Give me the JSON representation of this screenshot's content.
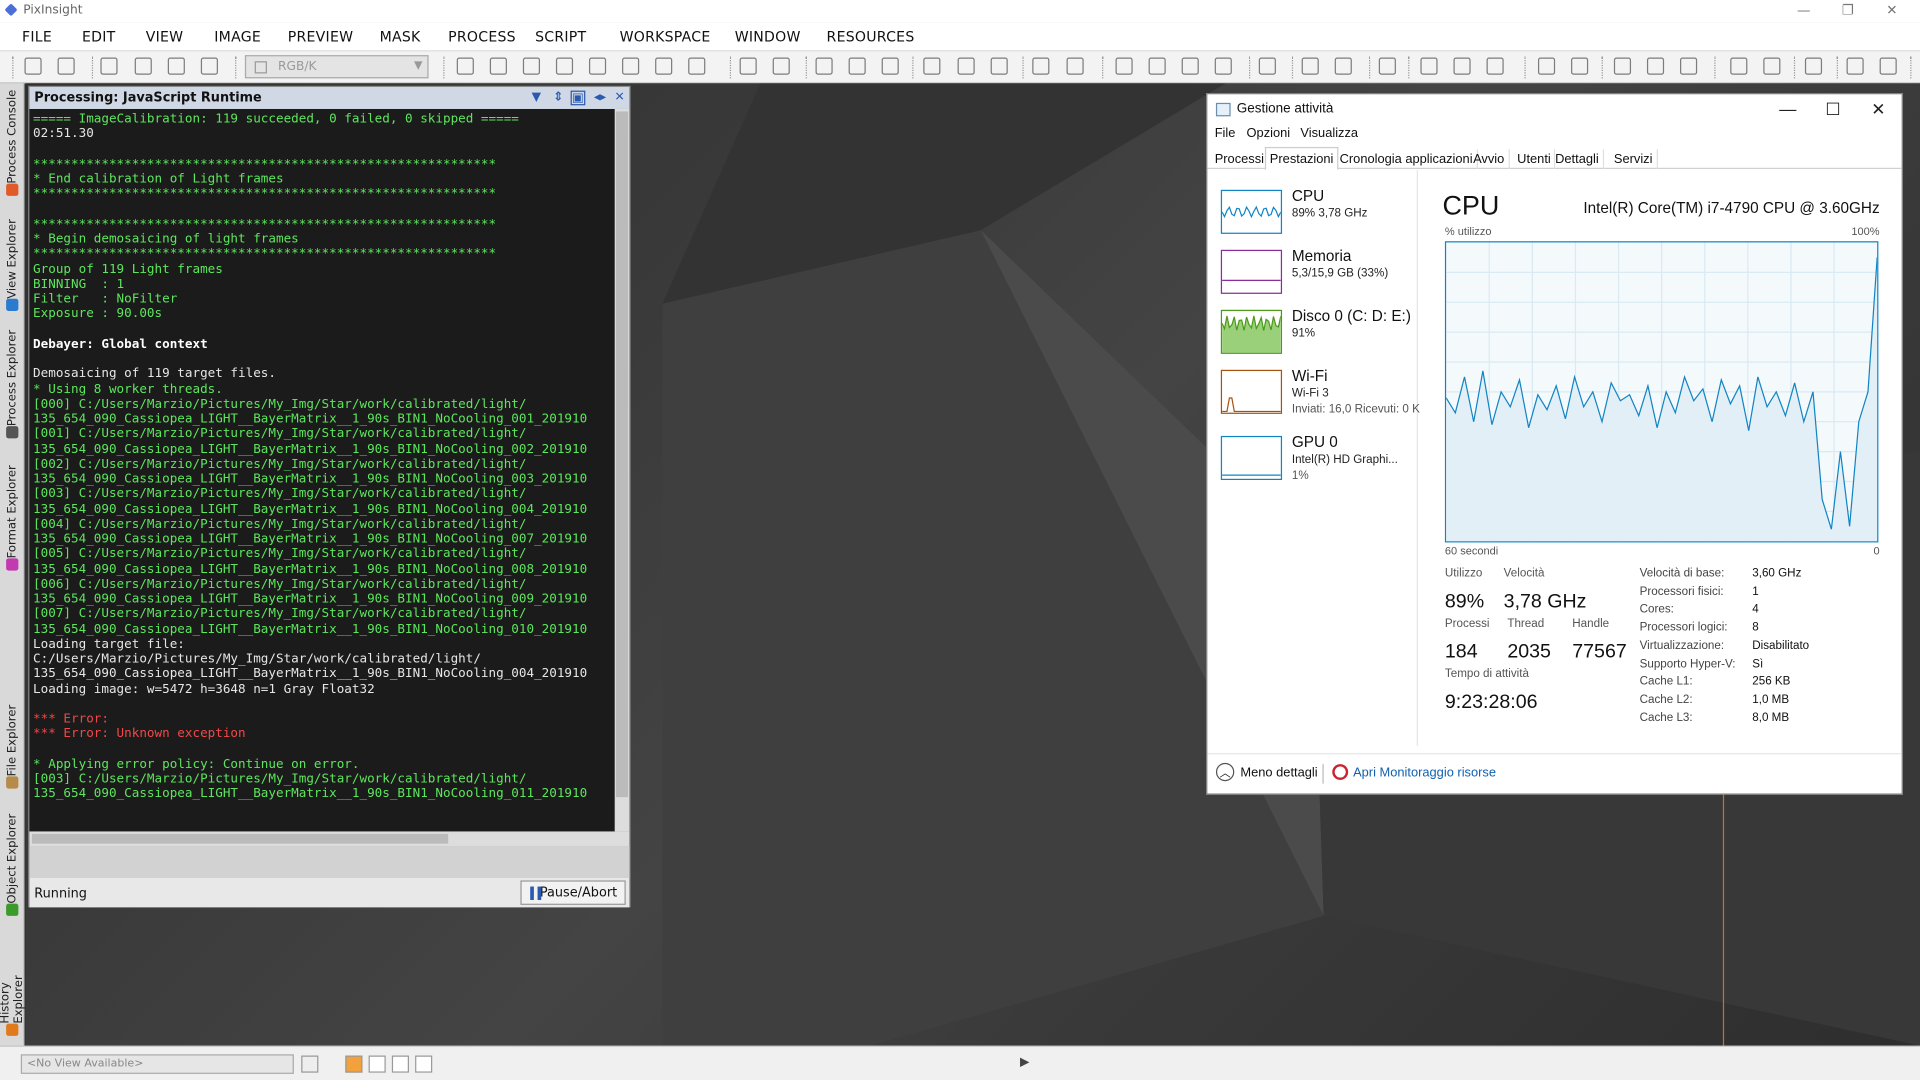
{
  "app": {
    "title": "PixInsight"
  },
  "menu": [
    "FILE",
    "EDIT",
    "VIEW",
    "IMAGE",
    "PREVIEW",
    "MASK",
    "PROCESS",
    "SCRIPT",
    "WORKSPACE",
    "WINDOW",
    "RESOURCES"
  ],
  "toolbar": {
    "color_space": "RGB/K"
  },
  "left_tabs": [
    "Process Console",
    "View Explorer",
    "Process Explorer",
    "Format Explorer",
    "File Explorer",
    "Object Explorer",
    "History Explorer"
  ],
  "console": {
    "title": "Processing: JavaScript Runtime",
    "lines": [
      {
        "t": "===== ImageCalibration: 119 succeeded, 0 failed, 0 skipped =====",
        "c": "g"
      },
      {
        "t": "02:51.30",
        "c": "w"
      },
      {
        "t": "",
        "c": "w"
      },
      {
        "t": "*************************************************************",
        "c": "g"
      },
      {
        "t": "* End calibration of Light frames",
        "c": "g"
      },
      {
        "t": "*************************************************************",
        "c": "g"
      },
      {
        "t": "",
        "c": "w"
      },
      {
        "t": "*************************************************************",
        "c": "g"
      },
      {
        "t": "* Begin demosaicing of light frames",
        "c": "g"
      },
      {
        "t": "*************************************************************",
        "c": "g"
      },
      {
        "t": "Group of 119 Light frames",
        "c": "g"
      },
      {
        "t": "BINNING  : 1",
        "c": "g"
      },
      {
        "t": "Filter   : NoFilter",
        "c": "g"
      },
      {
        "t": "Exposure : 90.00s",
        "c": "g"
      },
      {
        "t": "",
        "c": "w"
      },
      {
        "t": "Debayer: Global context",
        "c": "b"
      },
      {
        "t": "",
        "c": "w"
      },
      {
        "t": "Demosaicing of 119 target files.",
        "c": "w"
      },
      {
        "t": "* Using 8 worker threads.",
        "c": "g"
      },
      {
        "t": "[000] C:/Users/Marzio/Pictures/My_Img/Star/work/calibrated/light/",
        "c": "g"
      },
      {
        "t": "135_654_090_Cassiopea_LIGHT__BayerMatrix__1_90s_BIN1_NoCooling_001_201910",
        "c": "g"
      },
      {
        "t": "[001] C:/Users/Marzio/Pictures/My_Img/Star/work/calibrated/light/",
        "c": "g"
      },
      {
        "t": "135_654_090_Cassiopea_LIGHT__BayerMatrix__1_90s_BIN1_NoCooling_002_201910",
        "c": "g"
      },
      {
        "t": "[002] C:/Users/Marzio/Pictures/My_Img/Star/work/calibrated/light/",
        "c": "g"
      },
      {
        "t": "135_654_090_Cassiopea_LIGHT__BayerMatrix__1_90s_BIN1_NoCooling_003_201910",
        "c": "g"
      },
      {
        "t": "[003] C:/Users/Marzio/Pictures/My_Img/Star/work/calibrated/light/",
        "c": "g"
      },
      {
        "t": "135_654_090_Cassiopea_LIGHT__BayerMatrix__1_90s_BIN1_NoCooling_004_201910",
        "c": "g"
      },
      {
        "t": "[004] C:/Users/Marzio/Pictures/My_Img/Star/work/calibrated/light/",
        "c": "g"
      },
      {
        "t": "135_654_090_Cassiopea_LIGHT__BayerMatrix__1_90s_BIN1_NoCooling_007_201910",
        "c": "g"
      },
      {
        "t": "[005] C:/Users/Marzio/Pictures/My_Img/Star/work/calibrated/light/",
        "c": "g"
      },
      {
        "t": "135_654_090_Cassiopea_LIGHT__BayerMatrix__1_90s_BIN1_NoCooling_008_201910",
        "c": "g"
      },
      {
        "t": "[006] C:/Users/Marzio/Pictures/My_Img/Star/work/calibrated/light/",
        "c": "g"
      },
      {
        "t": "135_654_090_Cassiopea_LIGHT__BayerMatrix__1_90s_BIN1_NoCooling_009_201910",
        "c": "g"
      },
      {
        "t": "[007] C:/Users/Marzio/Pictures/My_Img/Star/work/calibrated/light/",
        "c": "g"
      },
      {
        "t": "135_654_090_Cassiopea_LIGHT__BayerMatrix__1_90s_BIN1_NoCooling_010_201910",
        "c": "g"
      },
      {
        "t": "Loading target file:",
        "c": "w"
      },
      {
        "t": "C:/Users/Marzio/Pictures/My_Img/Star/work/calibrated/light/",
        "c": "w"
      },
      {
        "t": "135_654_090_Cassiopea_LIGHT__BayerMatrix__1_90s_BIN1_NoCooling_004_201910",
        "c": "w"
      },
      {
        "t": "Loading image: w=5472 h=3648 n=1 Gray Float32",
        "c": "w"
      },
      {
        "t": "",
        "c": "w"
      },
      {
        "t": "*** Error:",
        "c": "r"
      },
      {
        "t": "*** Error: Unknown exception",
        "c": "r"
      },
      {
        "t": "",
        "c": "w"
      },
      {
        "t": "* Applying error policy: Continue on error.",
        "c": "g"
      },
      {
        "t": "[003] C:/Users/Marzio/Pictures/My_Img/Star/work/calibrated/light/",
        "c": "g"
      },
      {
        "t": "135_654_090_Cassiopea_LIGHT__BayerMatrix__1_90s_BIN1_NoCooling_011_201910",
        "c": "g"
      }
    ],
    "status": "Running",
    "pause_label": "Pause/Abort"
  },
  "statusbar": {
    "view": "<No View Available>"
  },
  "taskmgr": {
    "title": "Gestione attività",
    "menu": [
      "File",
      "Opzioni",
      "Visualizza"
    ],
    "tabs": [
      "Processi",
      "Prestazioni",
      "Cronologia applicazioni",
      "Avvio",
      "Utenti",
      "Dettagli",
      "Servizi"
    ],
    "active_tab": "Prestazioni",
    "side": [
      {
        "name": "CPU",
        "sub": "89% 3,78 GHz",
        "sub2": "",
        "color": "#1185c4"
      },
      {
        "name": "Memoria",
        "sub": "5,3/15,9 GB (33%)",
        "sub2": "",
        "color": "#8b2c9c"
      },
      {
        "name": "Disco 0 (C: D: E:)",
        "sub": "91%",
        "sub2": "",
        "color": "#4b9a1a"
      },
      {
        "name": "Wi-Fi",
        "sub": "Wi-Fi 3",
        "sub2": "Inviati: 16,0 Ricevuti: 0 K",
        "color": "#a8520f"
      },
      {
        "name": "GPU 0",
        "sub": "Intel(R) HD Graphi...",
        "sub2": "1%",
        "color": "#1185c4"
      }
    ],
    "cpu": {
      "heading": "CPU",
      "model": "Intel(R) Core(TM) i7-4790 CPU @ 3.60GHz",
      "util_label": "% utilizzo",
      "max_label": "100%",
      "span_label": "60 secondi",
      "zero_label": "0",
      "stats": [
        {
          "label": "Utilizzo",
          "value": "89%"
        },
        {
          "label": "Velocità",
          "value": "3,78 GHz"
        },
        {
          "label": "Processi",
          "value": "184"
        },
        {
          "label": "Thread",
          "value": "2035"
        },
        {
          "label": "Handle",
          "value": "77567"
        },
        {
          "label": "Tempo di attività",
          "value": "9:23:28:06"
        }
      ],
      "props": [
        {
          "k": "Velocità di base:",
          "v": "3,60 GHz"
        },
        {
          "k": "Processori fisici:",
          "v": "1"
        },
        {
          "k": "Cores:",
          "v": "4"
        },
        {
          "k": "Processori logici:",
          "v": "8"
        },
        {
          "k": "Virtualizzazione:",
          "v": "Disabilitato"
        },
        {
          "k": "Supporto Hyper-V:",
          "v": "Sì"
        },
        {
          "k": "Cache L1:",
          "v": "256 KB"
        },
        {
          "k": "Cache L2:",
          "v": "1,0 MB"
        },
        {
          "k": "Cache L3:",
          "v": "8,0 MB"
        }
      ]
    },
    "chart_data": {
      "type": "line",
      "ylim": [
        0,
        100
      ],
      "values": [
        48,
        43,
        55,
        40,
        57,
        39,
        50,
        45,
        54,
        38,
        49,
        44,
        52,
        41,
        55,
        45,
        50,
        40,
        53,
        47,
        49,
        42,
        52,
        38,
        50,
        43,
        55,
        47,
        51,
        40,
        54,
        46,
        52,
        37,
        55,
        45,
        50,
        42,
        53,
        40,
        50,
        14,
        4,
        30,
        5,
        40,
        50,
        95
      ]
    },
    "less_label": "Meno dettagli",
    "open_label": "Apri Monitoraggio risorse"
  }
}
